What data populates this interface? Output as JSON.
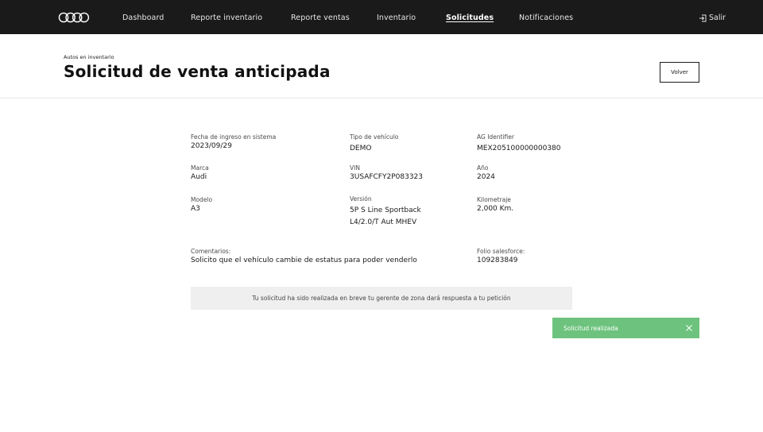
{
  "nav": {
    "items": [
      {
        "label": "Dashboard",
        "active": false
      },
      {
        "label": "Reporte inventario",
        "active": false
      },
      {
        "label": "Reporte ventas",
        "active": false
      },
      {
        "label": "Inventario",
        "active": false
      },
      {
        "label": "Solicitudes",
        "active": true
      },
      {
        "label": "Notificaciones",
        "active": false
      }
    ],
    "logout_label": "Salir"
  },
  "header": {
    "breadcrumb": "Autos en inventario",
    "title": "Solicitud de venta anticipada",
    "back_label": "Volver"
  },
  "fields": {
    "fecha": {
      "label": "Fecha de ingreso en sistema",
      "value": "2023/09/29"
    },
    "tipo": {
      "label": "Tipo de vehículo",
      "value": "DEMO"
    },
    "ag": {
      "label": "AG Identifier",
      "value": "MEX205100000000380"
    },
    "marca": {
      "label": "Marca",
      "value": "Audi"
    },
    "vin": {
      "label": "VIN",
      "value": "3USAFCFY2P083323"
    },
    "anio": {
      "label": "Año",
      "value": "2024"
    },
    "modelo": {
      "label": "Modelo",
      "value": "A3"
    },
    "version": {
      "label": "Versión",
      "value_line1": "5P S Line Sportback",
      "value_line2": "L4/2.0/T Aut MHEV"
    },
    "kilometraje": {
      "label": "Kilometraje",
      "value": "2,000 Km."
    },
    "comentarios": {
      "label": "Comentarios:",
      "value": "Solicito que el vehículo cambie de estatus para poder venderlo"
    },
    "folio": {
      "label": "Folio salesforce:",
      "value": "109283849"
    }
  },
  "notice": "Tu solicitud ha sido realizada en breve tu gerente de zona dará respuesta a tu petición",
  "toast": {
    "message": "Solicitud realizada",
    "color": "#6dc37d"
  },
  "colors": {
    "nav_bg": "#1a1a1a",
    "toast_bg": "#6dc37d"
  }
}
